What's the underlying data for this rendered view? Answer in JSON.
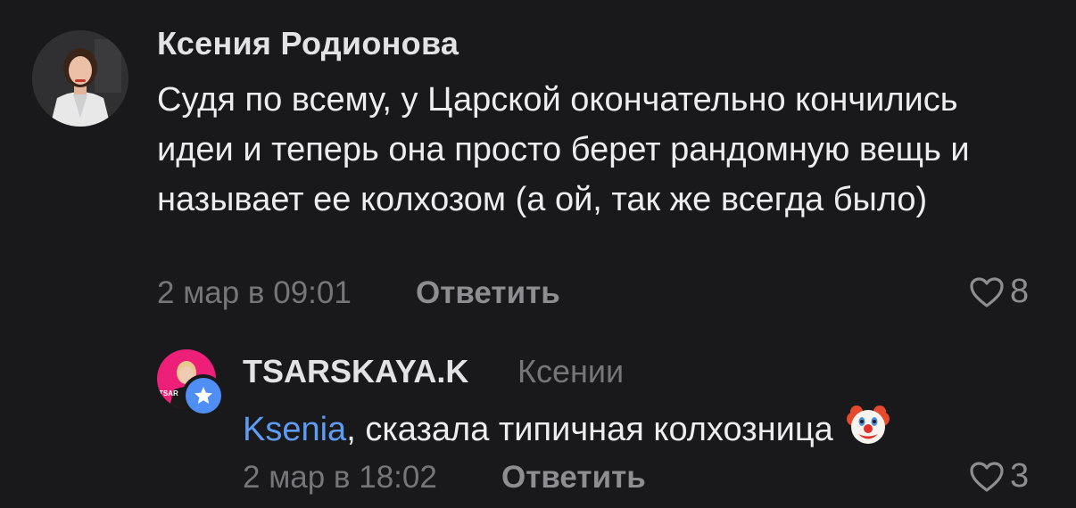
{
  "comments": [
    {
      "author": "Ксения Родионова",
      "text": "Судя по всему, у Царской окончательно кончились идеи и теперь она просто берет рандомную вещь и называет ее колхозом (а ой, так же всегда было)",
      "timestamp": "2 мар в 09:01",
      "reply_label": "Ответить",
      "likes": "8",
      "avatar_icon": "user-avatar-photo",
      "like_icon": "heart-outline-icon"
    },
    {
      "author": "TSARSKAYA.K",
      "reply_to": "Ксении",
      "mention": "Ksenia",
      "text": ", сказала типичная колхозница",
      "emoji": "🤡",
      "timestamp": "2 мар в 18:02",
      "reply_label": "Ответить",
      "likes": "3",
      "avatar_icon": "user-avatar-photo",
      "badge_icon": "star-badge-icon",
      "like_icon": "heart-outline-icon"
    }
  ],
  "colors": {
    "background": "#19191b",
    "text": "#ededef",
    "muted": "#76767a",
    "mention": "#5e9bf2",
    "badge": "#4f8ff5",
    "avatar2_bg": "#ee1f78"
  }
}
